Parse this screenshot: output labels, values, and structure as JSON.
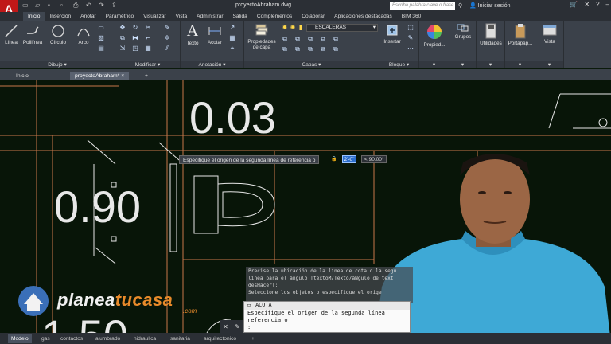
{
  "app": {
    "logo": "A",
    "file_title": "proyectoAbraham.dwg",
    "search_placeholder": "Escriba palabra clave o frase",
    "sign_in": "Iniciar sesión"
  },
  "ribbon_tabs": [
    "Inicio",
    "Inserción",
    "Anotar",
    "Paramétrico",
    "Visualizar",
    "Vista",
    "Administrar",
    "Salida",
    "Complementos",
    "Colaborar",
    "Aplicaciones destacadas",
    "BIM 360"
  ],
  "ribbon": {
    "draw": {
      "label": "Dibujo",
      "tools": [
        "Línea",
        "Polilínea",
        "Círculo",
        "Arco"
      ]
    },
    "modify": {
      "label": "Modificar"
    },
    "annotation": {
      "label": "Anotación",
      "tools": [
        "Texto",
        "Acotar"
      ]
    },
    "layers": {
      "label": "Capas",
      "tool": "Propiedades de capa",
      "current_layer": "ESCALERAS"
    },
    "block": {
      "label": "Bloque",
      "tool": "Insertar"
    },
    "properties": {
      "tool": "Propied..."
    },
    "groups": {
      "tool": "Grupos"
    },
    "utilities": {
      "tool": "Utilidades"
    },
    "clipboard": {
      "tool": "Portapap..."
    },
    "view": {
      "tool": "Vista"
    }
  },
  "file_tabs": [
    "Inicio",
    "proyectoAbraham*"
  ],
  "drawing": {
    "dim_1": "0.03",
    "dim_2": "0.90",
    "dim_3": "1.50"
  },
  "dynamic_prompt": {
    "text": "Especifique el origen de la segunda línea de referencia o",
    "value": "2'-0\"",
    "angle": "< 90.00°"
  },
  "command_history": [
    "Precise la ubicación de la línea de cota o la segu",
    "línea para el ángulo [textoM/Texto/áNgulo de text",
    "desHacer]:",
    "Seleccione los objetos o especifique el orige"
  ],
  "command_line": {
    "command": "ACOTA",
    "line1": "Especifique el origen de la segunda línea",
    "line2": "referencia o",
    "line3": ":"
  },
  "watermark": {
    "part1": "planea",
    "part2": "tucasa",
    "sub": ".com"
  },
  "layout_tabs": [
    "Modelo",
    "gas",
    "contactos",
    "alumbrado",
    "hidraulica",
    "sanitaria",
    "arquitectonico"
  ],
  "colors": {
    "title_bg": "#2b2f35",
    "ribbon_bg": "#3b414a",
    "canvas_bg": "#081508",
    "geometry_orange": "#c8764a",
    "geometry_white": "#e8e8e8",
    "accent_blue": "#2d6ecc"
  }
}
